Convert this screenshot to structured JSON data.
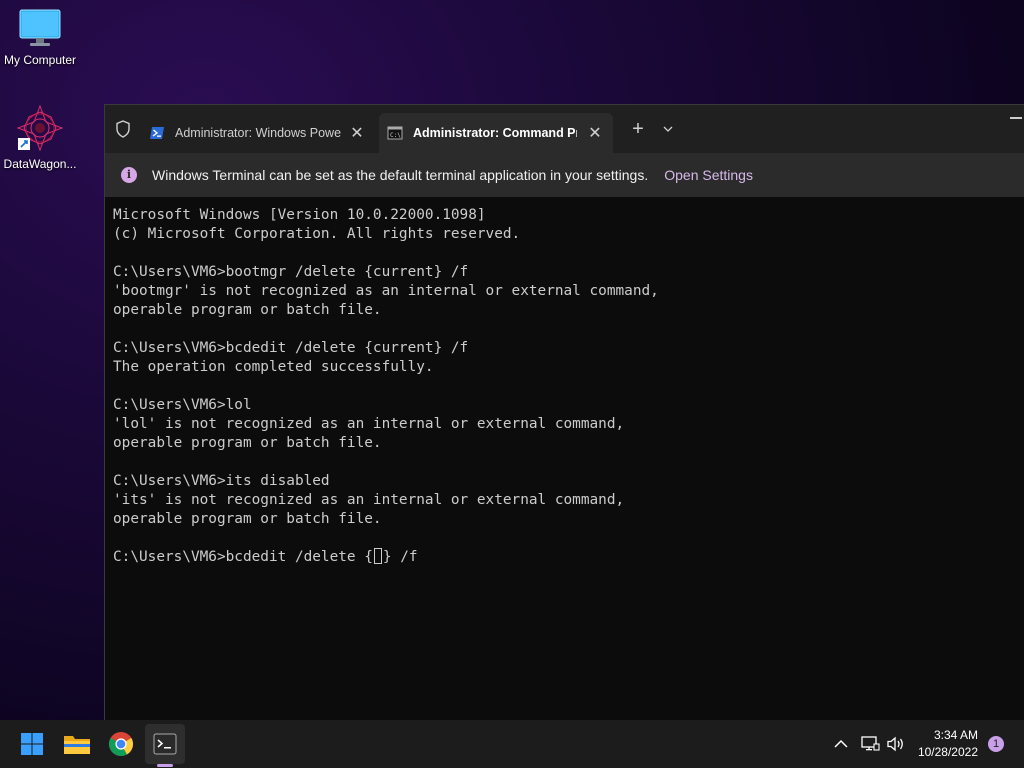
{
  "desktop": {
    "icons": [
      {
        "label": "My Computer",
        "icon": "monitor-icon"
      },
      {
        "label": "DataWagon...",
        "icon": "datawagon-shortcut-icon"
      }
    ]
  },
  "terminal": {
    "tabs": [
      {
        "title": "Administrator: Windows Power",
        "icon": "powershell-icon",
        "active": false
      },
      {
        "title": "Administrator: Command Pro",
        "icon": "cmd-icon",
        "active": true
      }
    ],
    "infobar": {
      "message": "Windows Terminal can be set as the default terminal application in your settings.",
      "link": "Open Settings"
    },
    "console": {
      "lines": [
        "Microsoft Windows [Version 10.0.22000.1098]",
        "(c) Microsoft Corporation. All rights reserved.",
        "",
        "C:\\Users\\VM6>bootmgr /delete {current} /f",
        "'bootmgr' is not recognized as an internal or external command,",
        "operable program or batch file.",
        "",
        "C:\\Users\\VM6>bcdedit /delete {current} /f",
        "The operation completed successfully.",
        "",
        "C:\\Users\\VM6>lol",
        "'lol' is not recognized as an internal or external command,",
        "operable program or batch file.",
        "",
        "C:\\Users\\VM6>its disabled",
        "'its' is not recognized as an internal or external command,",
        "operable program or batch file.",
        ""
      ],
      "current_input_before": "C:\\Users\\VM6>bcdedit /delete {",
      "current_input_after": "} /f"
    }
  },
  "taskbar": {
    "apps": [
      "windows-start",
      "file-explorer",
      "chrome",
      "terminal"
    ],
    "clock": {
      "time": "3:34 AM",
      "date": "10/28/2022"
    },
    "notification_count": "1"
  },
  "colors": {
    "accent": "#c8a0e8",
    "console_text": "#cccccc",
    "console_bg": "#0c0c0c"
  }
}
